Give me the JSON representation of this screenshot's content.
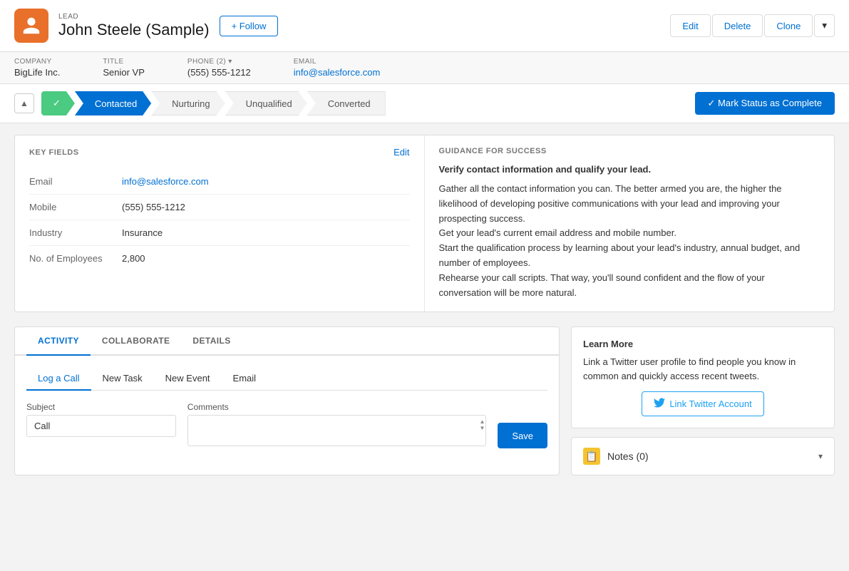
{
  "header": {
    "lead_label": "LEAD",
    "lead_name": "John Steele (Sample)",
    "follow_label": "+ Follow",
    "edit_label": "Edit",
    "delete_label": "Delete",
    "clone_label": "Clone"
  },
  "subheader": {
    "company_label": "COMPANY",
    "company_value": "BigLife Inc.",
    "title_label": "TITLE",
    "title_value": "Senior VP",
    "phone_label": "PHONE (2)",
    "phone_value": "(555) 555-1212",
    "email_label": "EMAIL",
    "email_value": "info@salesforce.com"
  },
  "status_bar": {
    "step1": "✓",
    "step2_label": "Contacted",
    "step3_label": "Nurturing",
    "step4_label": "Unqualified",
    "step5_label": "Converted",
    "mark_complete_label": "✓  Mark Status as Complete"
  },
  "key_fields": {
    "section_title": "KEY FIELDS",
    "edit_label": "Edit",
    "fields": [
      {
        "label": "Email",
        "value": "info@salesforce.com",
        "is_link": true
      },
      {
        "label": "Mobile",
        "value": "(555) 555-1212",
        "is_link": false
      },
      {
        "label": "Industry",
        "value": "Insurance",
        "is_link": false
      },
      {
        "label": "No. of Employees",
        "value": "2,800",
        "is_link": false
      }
    ]
  },
  "guidance": {
    "section_title": "GUIDANCE FOR SUCCESS",
    "bold_text": "Verify contact information and qualify your lead.",
    "paragraphs": [
      "Gather all the contact information you can. The better armed you are, the higher the likelihood of developing positive communications with your lead and improving your prospecting success.",
      "Get your lead's current email address and mobile number.",
      "Start the qualification process by learning about your lead's industry, annual budget, and number of employees.",
      "Rehearse your call scripts. That way, you'll sound confident and the flow of your conversation will be more natural."
    ]
  },
  "activity": {
    "tabs": [
      "ACTIVITY",
      "COLLABORATE",
      "DETAILS"
    ],
    "sub_tabs": [
      "Log a Call",
      "New Task",
      "New Event",
      "Email"
    ],
    "subject_label": "Subject",
    "subject_value": "Call",
    "comments_label": "Comments",
    "save_label": "Save"
  },
  "learn_more": {
    "title": "Learn More",
    "text": "Link a Twitter user profile to find people you know in common and quickly access recent tweets.",
    "button_label": "Link Twitter Account"
  },
  "notes": {
    "title": "Notes (0)"
  }
}
